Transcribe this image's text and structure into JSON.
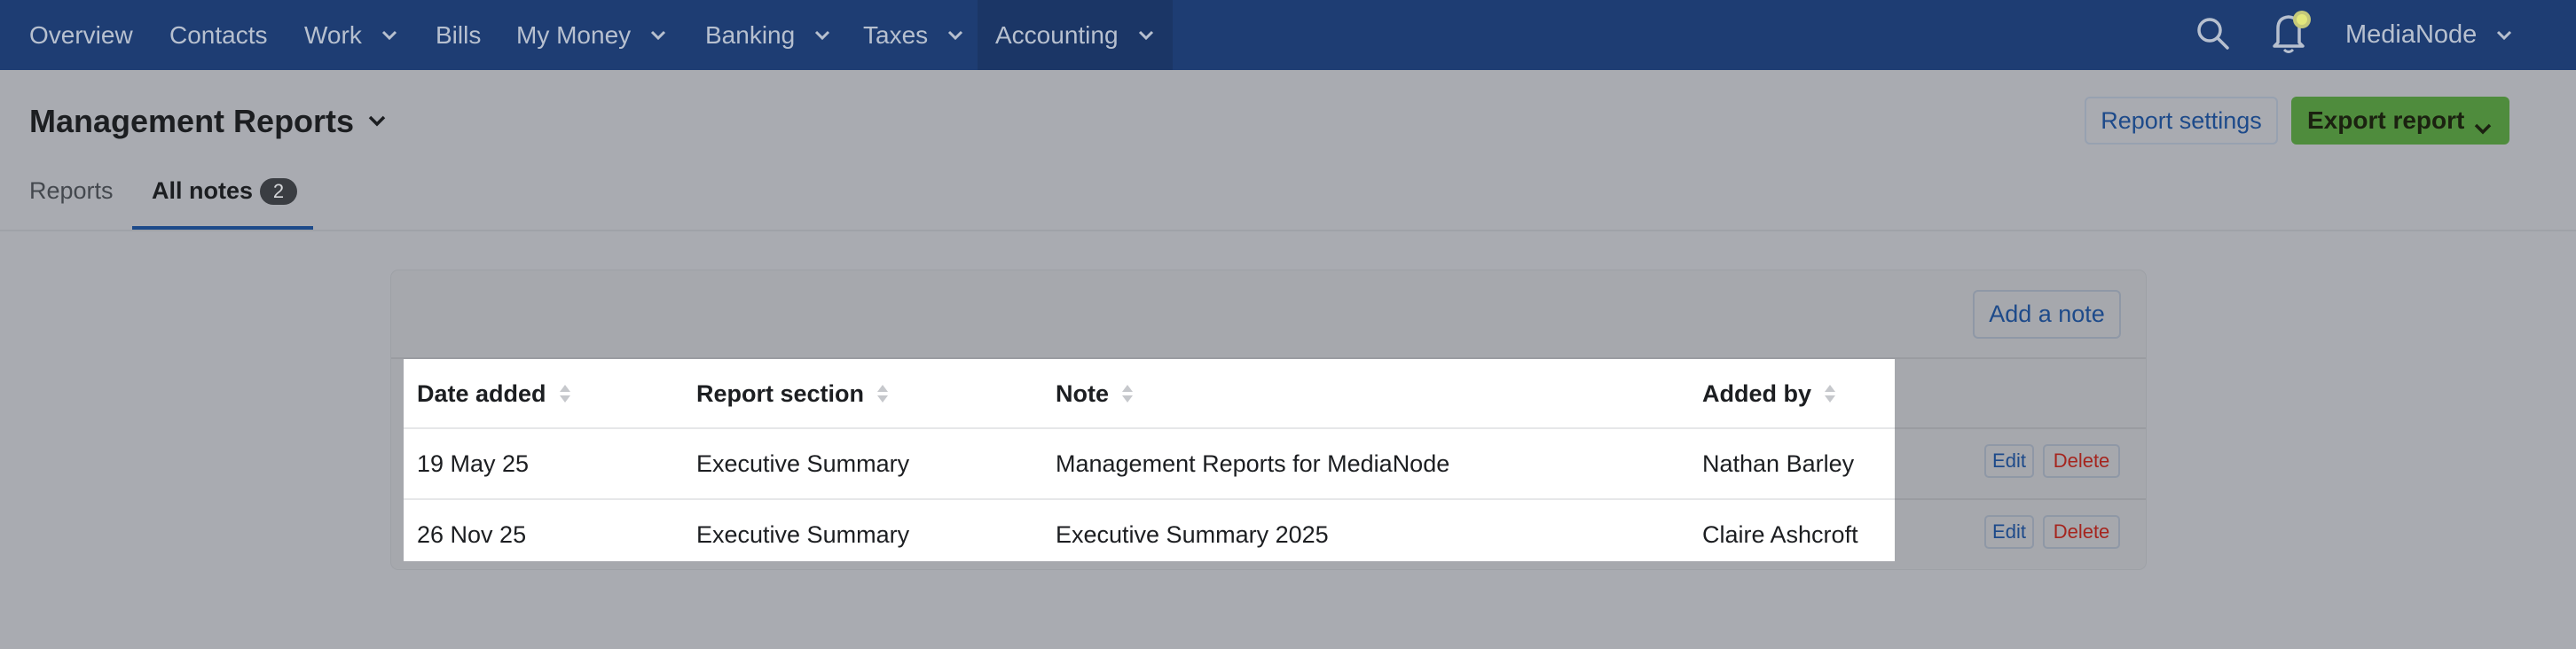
{
  "nav": {
    "items": [
      {
        "label": "Overview",
        "has_chevron": false,
        "active": false
      },
      {
        "label": "Contacts",
        "has_chevron": false,
        "active": false
      },
      {
        "label": "Work",
        "has_chevron": true,
        "active": false
      },
      {
        "label": "Bills",
        "has_chevron": false,
        "active": false
      },
      {
        "label": "My Money",
        "has_chevron": true,
        "active": false
      },
      {
        "label": "Banking",
        "has_chevron": true,
        "active": false
      },
      {
        "label": "Taxes",
        "has_chevron": true,
        "active": false
      },
      {
        "label": "Accounting",
        "has_chevron": true,
        "active": true
      }
    ],
    "search_icon": "search-icon",
    "bell_icon": "bell-icon",
    "org_name": "MediaNode"
  },
  "header": {
    "title": "Management Reports",
    "settings_label": "Report settings",
    "export_label": "Export report"
  },
  "tabs": {
    "reports_label": "Reports",
    "notes_label": "All notes",
    "notes_count": "2"
  },
  "notes": {
    "add_label": "Add a note",
    "columns": [
      "Date added",
      "Report section",
      "Note",
      "Added by"
    ],
    "rows": [
      {
        "date": "19 May 25",
        "section": "Executive Summary",
        "note": "Management Reports for MediaNode",
        "added_by": "Nathan Barley"
      },
      {
        "date": "26 Nov 25",
        "section": "Executive Summary",
        "note": "Executive Summary 2025",
        "added_by": "Claire Ashcroft"
      }
    ],
    "edit_label": "Edit",
    "delete_label": "Delete"
  },
  "colors": {
    "nav_bg": "#1e3d73",
    "nav_active_bg": "#1b3666",
    "accent": "#1d4a8a",
    "export_bg": "#4f8c3d",
    "delete": "#a5251e",
    "overlay": "#a9abb1"
  }
}
